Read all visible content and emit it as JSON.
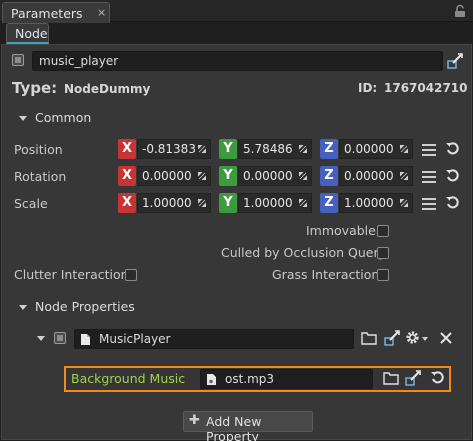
{
  "window": {
    "title": "Parameters",
    "close_glyph": "×"
  },
  "tabs": [
    {
      "label": "Node"
    }
  ],
  "node": {
    "name": "music_player",
    "type_label": "Type:",
    "type_value": "NodeDummy",
    "id_label": "ID:",
    "id_value": "1767042710"
  },
  "common": {
    "title": "Common",
    "rows": [
      {
        "label": "Position",
        "x": "-0.81383",
        "y": "5.78486",
        "z": "0.00000"
      },
      {
        "label": "Rotation",
        "x": "0.00000",
        "y": "0.00000",
        "z": "0.00000"
      },
      {
        "label": "Scale",
        "x": "1.00000",
        "y": "1.00000",
        "z": "1.00000"
      }
    ],
    "axis_labels": {
      "x": "X",
      "y": "Y",
      "z": "Z"
    },
    "flags": {
      "immovable": "Immovable",
      "culled": "Culled by Occlusion Query",
      "clutter": "Clutter Interaction",
      "grass": "Grass Interaction"
    }
  },
  "node_properties": {
    "title": "Node Properties",
    "property_name": "MusicPlayer",
    "params": [
      {
        "label": "Background Music",
        "value": "ost.mp3"
      }
    ],
    "add_button": "Add New Property"
  },
  "colors": {
    "x_axis": "#c73434",
    "y_axis": "#3e9a3e",
    "z_axis": "#4660c0",
    "highlight": "#f08a1c",
    "param_label": "#a6d04a",
    "tab_accent": "#3fa3b9"
  }
}
